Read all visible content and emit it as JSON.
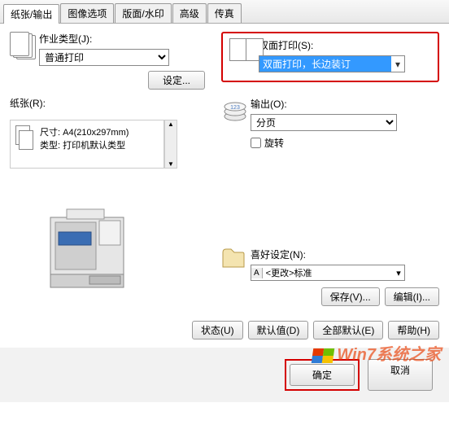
{
  "tabs": {
    "paper_output": "纸张/输出",
    "image_options": "图像选项",
    "layout_watermark": "版面/水印",
    "advanced": "高级",
    "fax": "传真"
  },
  "job_type": {
    "label": "作业类型(J):",
    "value": "普通打印",
    "settings_btn": "设定..."
  },
  "paper": {
    "label": "纸张(R):",
    "size": "尺寸: A4(210x297mm)",
    "type": "类型: 打印机默认类型"
  },
  "duplex": {
    "label": "双面打印(S):",
    "value": "双面打印，长边装订"
  },
  "output": {
    "label": "输出(O):",
    "value": "分页"
  },
  "rotate": {
    "label": "旋转"
  },
  "favorite": {
    "label": "喜好设定(N):",
    "badge": "A",
    "value": "<更改>标准",
    "save_btn": "保存(V)...",
    "edit_btn": "编辑(I)..."
  },
  "bottom": {
    "status": "状态(U)",
    "defaults": "默认值(D)",
    "all_defaults": "全部默认(E)",
    "help": "帮助(H)"
  },
  "footer": {
    "ok": "确定",
    "cancel": "取消"
  },
  "watermark": "Win7系统之家"
}
